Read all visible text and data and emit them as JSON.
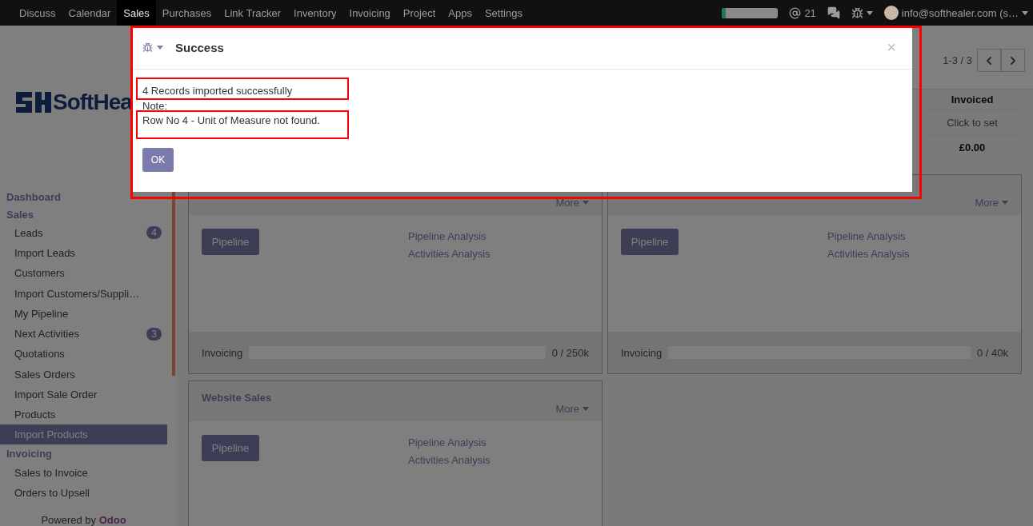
{
  "navbar": {
    "apps": [
      {
        "label": "Discuss",
        "selected": false
      },
      {
        "label": "Calendar",
        "selected": false
      },
      {
        "label": "Sales",
        "selected": true
      },
      {
        "label": "Purchases",
        "selected": false
      },
      {
        "label": "Link Tracker",
        "selected": false
      },
      {
        "label": "Inventory",
        "selected": false
      },
      {
        "label": "Invoicing",
        "selected": false
      },
      {
        "label": "Project",
        "selected": false
      },
      {
        "label": "Apps",
        "selected": false
      },
      {
        "label": "Settings",
        "selected": false
      }
    ],
    "progress": {
      "level": 0.07
    },
    "mentions": "21",
    "user": "info@softhealer.com (s…"
  },
  "sidebar": {
    "logo": "SoftHea",
    "sections": [
      {
        "title": "Dashboard"
      },
      {
        "title": "Sales",
        "items": [
          {
            "label": "Leads",
            "badge": "4",
            "selected": false
          },
          {
            "label": "Import Leads",
            "selected": false
          },
          {
            "label": "Customers",
            "selected": false
          },
          {
            "label": "Import Customers/Suppli…",
            "selected": false
          },
          {
            "label": "My Pipeline",
            "selected": false
          },
          {
            "label": "Next Activities",
            "badge": "3",
            "selected": false
          },
          {
            "label": "Quotations",
            "selected": false
          },
          {
            "label": "Sales Orders",
            "selected": false
          },
          {
            "label": "Import Sale Order",
            "selected": false
          },
          {
            "label": "Products",
            "selected": false
          },
          {
            "label": "Import Products",
            "selected": true
          }
        ]
      },
      {
        "title": "Invoicing",
        "items": [
          {
            "label": "Sales to Invoice",
            "selected": false
          },
          {
            "label": "Orders to Upsell",
            "selected": false
          }
        ]
      }
    ],
    "footer": {
      "text": "Powered by",
      "brand": "Odoo"
    }
  },
  "pager": {
    "range": "1-3 / 3"
  },
  "summary_column": {
    "header": "Invoiced",
    "rows": [
      "Click to set",
      "£0.00"
    ]
  },
  "cards": [
    {
      "more": "More",
      "button": "Pipeline",
      "links": [
        "Pipeline Analysis",
        "Activities Analysis"
      ],
      "footer": {
        "label": "Invoicing",
        "level": 0,
        "reading": "0 / 250k"
      }
    },
    {
      "more": "More",
      "button": "Pipeline",
      "links": [
        "Pipeline Analysis",
        "Activities Analysis"
      ],
      "footer": {
        "label": "Invoicing",
        "level": 0,
        "reading": "0 / 40k"
      }
    },
    {
      "title": "Website Sales",
      "more": "More",
      "button": "Pipeline",
      "links": [
        "Pipeline Analysis",
        "Activities Analysis"
      ]
    }
  ],
  "dialog": {
    "title": "Success",
    "close": "×",
    "lines": [
      "4 Records imported successfully",
      "Note:",
      "Row No 4  - Unit of Measure not found."
    ],
    "button": "OK"
  }
}
